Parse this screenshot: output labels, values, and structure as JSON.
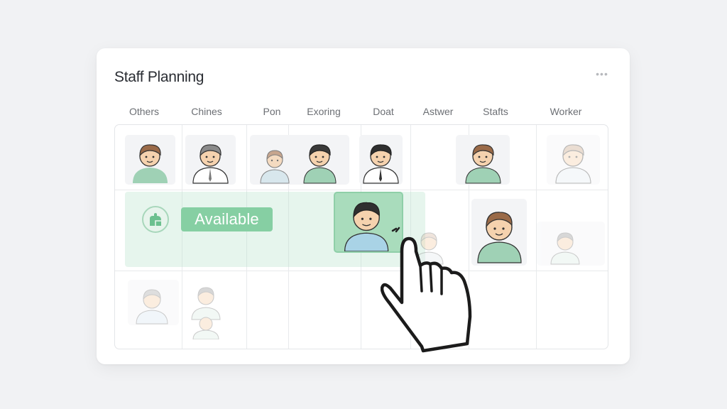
{
  "panel": {
    "title": "Staff Planning",
    "more_label": "•••"
  },
  "columns": [
    "Others",
    "Chines",
    "Pon",
    "Exoring",
    "Doat",
    "Astwer",
    "Stafts",
    "Worker"
  ],
  "status": {
    "label": "Available"
  },
  "colors": {
    "accent": "#86cfa3",
    "accent_light": "#b7e2cb",
    "avatar_shirt_green": "#9fd1b5",
    "avatar_hair_brown": "#9a6a48",
    "avatar_hair_dark": "#3a3a3a"
  },
  "icons": [
    "more-icon",
    "calendar-badge-icon",
    "hand-cursor-icon"
  ]
}
